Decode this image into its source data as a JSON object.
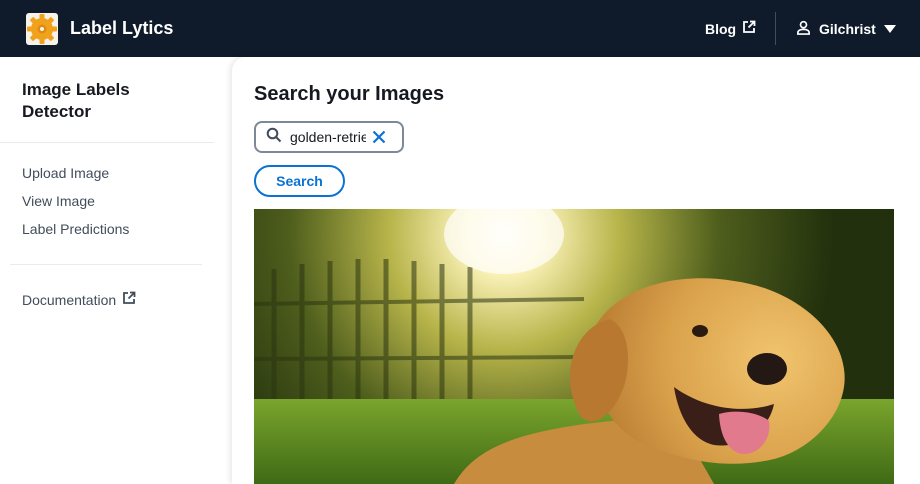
{
  "header": {
    "app_title": "Label Lytics",
    "blog_label": "Blog",
    "user_name": "Gilchrist",
    "logo_icon": "gear-cog-logo",
    "colors": {
      "bar": "#0f1b2a",
      "text": "#ffffff"
    }
  },
  "sidebar": {
    "header": "Image Labels Detector",
    "items": [
      {
        "label": "Upload Image"
      },
      {
        "label": "View Image"
      },
      {
        "label": "Label Predictions"
      }
    ],
    "documentation_label": "Documentation"
  },
  "main": {
    "heading": "Search your Images",
    "search": {
      "value": "golden-retriever"
    },
    "search_button_label": "Search",
    "accent_color": "#0972d3",
    "image": {
      "subject": "golden-retriever-photo"
    }
  }
}
